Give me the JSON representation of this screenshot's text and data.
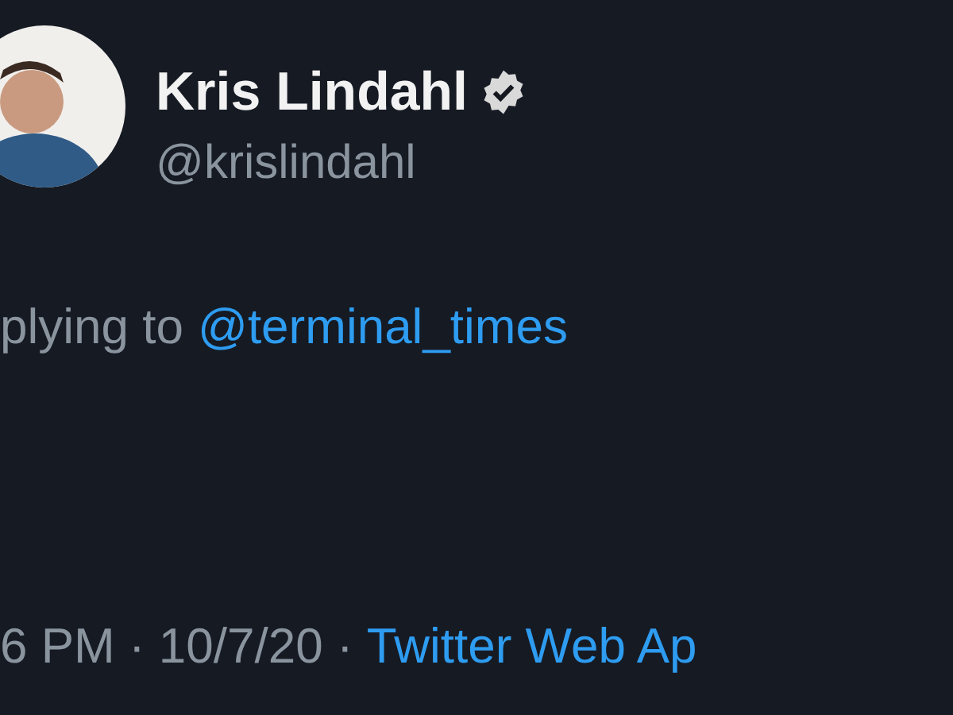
{
  "author": {
    "name": "Kris Lindahl",
    "verified": true,
    "handle": "@krislindahl"
  },
  "reply": {
    "prefix": "plying to",
    "mention": "@terminal_times"
  },
  "meta": {
    "time": "6 PM · 10/7/20 · ",
    "source": "Twitter Web Ap"
  }
}
